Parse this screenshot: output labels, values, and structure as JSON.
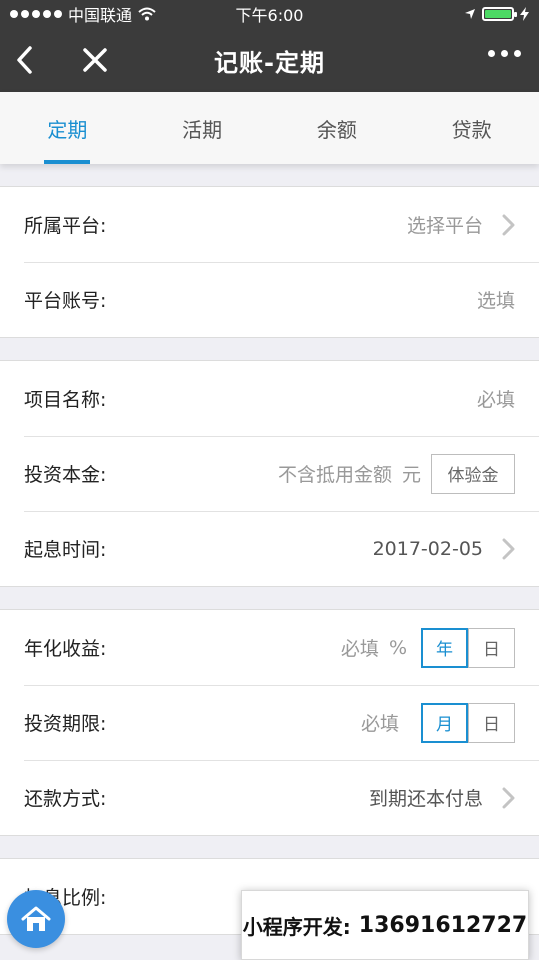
{
  "status_bar": {
    "carrier": "中国联通",
    "time": "下午6:00"
  },
  "nav": {
    "title": "记账-定期"
  },
  "tabs": [
    {
      "label": "定期",
      "active": true
    },
    {
      "label": "活期",
      "active": false
    },
    {
      "label": "余额",
      "active": false
    },
    {
      "label": "贷款",
      "active": false
    }
  ],
  "form": {
    "platform": {
      "label": "所属平台:",
      "value": "选择平台"
    },
    "account": {
      "label": "平台账号:",
      "placeholder": "选填"
    },
    "project": {
      "label": "项目名称:",
      "placeholder": "必填"
    },
    "principal": {
      "label": "投资本金:",
      "placeholder": "不含抵用金额",
      "unit": "元",
      "button": "体验金"
    },
    "start_date": {
      "label": "起息时间:",
      "value": "2017-02-05"
    },
    "annual_yield": {
      "label": "年化收益:",
      "placeholder": "必填",
      "unit": "%",
      "opt_year": "年",
      "opt_day": "日"
    },
    "term": {
      "label": "投资期限:",
      "placeholder": "必填",
      "opt_month": "月",
      "opt_day": "日"
    },
    "repayment": {
      "label": "还款方式:",
      "value": "到期还本付息"
    },
    "bonus": {
      "label": "加息比例:"
    }
  },
  "watermark": {
    "prefix": "小程序开发:",
    "number": "13691612727"
  },
  "colors": {
    "accent": "#1a8fd1",
    "navbar": "#3b3b3b",
    "battery": "#4cd964",
    "home_button": "#3a8fe0"
  }
}
